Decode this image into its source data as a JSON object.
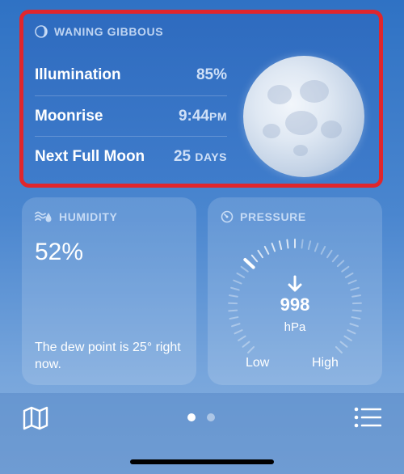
{
  "moon": {
    "header": "WANING GIBBOUS",
    "rows": [
      {
        "label": "Illumination",
        "value": "85%",
        "value_suffix": ""
      },
      {
        "label": "Moonrise",
        "value": "9:44",
        "value_suffix": "PM"
      },
      {
        "label": "Next Full Moon",
        "value": "25",
        "value_suffix": "DAYS"
      }
    ]
  },
  "humidity": {
    "header": "HUMIDITY",
    "value": "52%",
    "description": "The dew point is 25° right now."
  },
  "pressure": {
    "header": "PRESSURE",
    "value": "998",
    "unit": "hPa",
    "low_label": "Low",
    "high_label": "High",
    "trend": "falling"
  },
  "page_indicator": {
    "count": 2,
    "active": 0
  },
  "icons": {
    "moon_phase": "moon-phase-icon",
    "humidity": "humidity-icon",
    "pressure": "gauge-icon",
    "map": "map-icon",
    "list": "list-icon"
  },
  "colors": {
    "highlight": "#e0262c",
    "accent_text": "#cfe0f7"
  }
}
